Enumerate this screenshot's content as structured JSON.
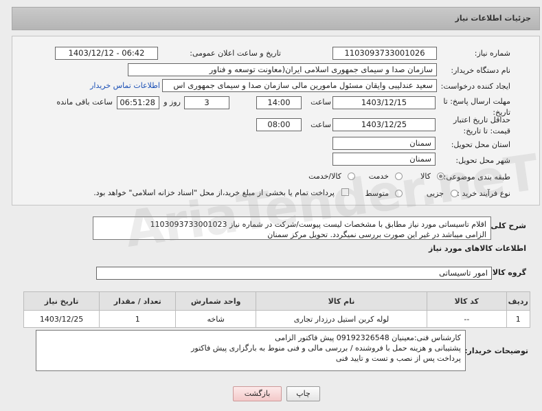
{
  "header": {
    "title": "جزئیات اطلاعات نیاز"
  },
  "form": {
    "need_number_label": "شماره نیاز:",
    "need_number": "1103093733001026",
    "announce_label": "تاریخ و ساعت اعلان عمومی:",
    "announce_value": "1403/12/12 - 06:42",
    "buyer_org_label": "نام دستگاه خریدار:",
    "buyer_org": "سازمان صدا و سیمای جمهوری اسلامی ایران(معاونت توسعه و فناور",
    "creator_label": "ایجاد کننده درخواست:",
    "creator": "سعید عندلیبی وایقان مسئول مامورین مالی  سازمان صدا و سیمای جمهوری اس",
    "contact_link": "اطلاعات تماس خریدار",
    "deadline_label": "مهلت ارسال پاسخ: تا تاریخ:",
    "deadline_date": "1403/12/15",
    "time_label": "ساعت",
    "deadline_time": "14:00",
    "days_value": "3",
    "days_label": "روز و",
    "remaining_time": "06:51:28",
    "remaining_label": "ساعت باقی مانده",
    "validity_label": "حداقل تاریخ اعتبار قیمت: تا تاریخ:",
    "validity_date": "1403/12/25",
    "validity_time": "08:00",
    "province_label": "استان محل تحویل:",
    "province": "سمنان",
    "city_label": "شهر محل تحویل:",
    "city": "سمنان",
    "category_label": "طبقه بندی موضوعی:",
    "category_options": [
      "کالا",
      "خدمت",
      "کالا/خدمت"
    ],
    "process_label": "نوع فرآیند خرید :",
    "process_options": [
      "جزیی",
      "متوسط"
    ],
    "payment_note": "پرداخت تمام یا بخشی از مبلغ خرید،از محل \"اسناد خزانه اسلامی\" خواهد بود."
  },
  "summary": {
    "label": "شرح کلی نیاز:",
    "line1": "اقلام تاسیساتی مورد نیاز مطابق با مشخصات لیست پیوست/شرکت در شماره نیاز 1103093733001023",
    "line2": "الزامی میباشد در غیر این صورت بررسی نمیگردد. تحویل مرکز سمنان"
  },
  "goods": {
    "section_title": "اطلاعات کالاهای مورد نیاز",
    "group_label": "گروه کالا:",
    "group_value": "امور تاسیساتی",
    "columns": [
      "ردیف",
      "کد کالا",
      "نام کالا",
      "واحد شمارش",
      "تعداد / مقدار",
      "تاریخ نیاز"
    ],
    "rows": [
      [
        "1",
        "--",
        "لوله کربن استیل درزدار تجاری",
        "شاخه",
        "1",
        "1403/12/25"
      ]
    ]
  },
  "buyer_notes": {
    "label": "توضیحات خریدار:",
    "line1": "کارشناس فنی:معینیان 09192326548 پیش فاکتور الزامی",
    "line2": "پشتیبانی و هزینه حمل با فروشنده / بررسی مالی و فنی منوط به بارگزاری پیش فاکتور",
    "line3": "پرداخت پس از نصب و تست و تایید فنی"
  },
  "buttons": {
    "print": "چاپ",
    "back": "بازگشت"
  },
  "watermark": "AriaTender.neT"
}
